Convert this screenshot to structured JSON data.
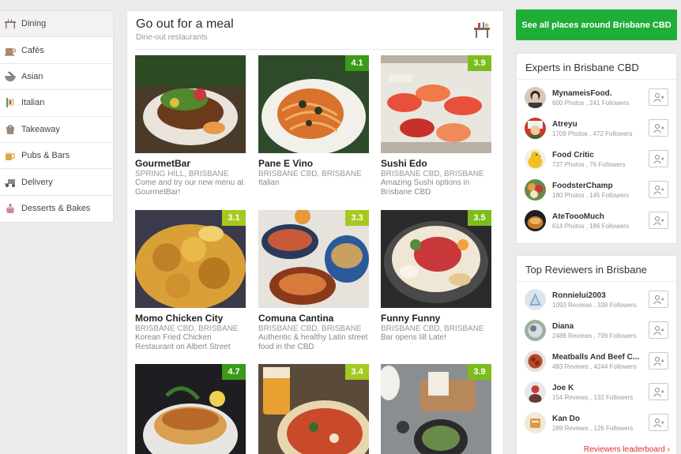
{
  "sidebar": {
    "items": [
      {
        "label": "Dining",
        "icon": "dining-icon"
      },
      {
        "label": "Cafés",
        "icon": "cafe-icon"
      },
      {
        "label": "Asian",
        "icon": "asian-icon"
      },
      {
        "label": "Italian",
        "icon": "italian-icon"
      },
      {
        "label": "Takeaway",
        "icon": "takeaway-icon"
      },
      {
        "label": "Pubs & Bars",
        "icon": "pubs-icon"
      },
      {
        "label": "Delivery",
        "icon": "delivery-icon"
      },
      {
        "label": "Desserts & Bakes",
        "icon": "desserts-icon"
      }
    ]
  },
  "main": {
    "title": "Go out for a meal",
    "subtitle": "Dine-out restaurants",
    "icon": "table-setting-icon",
    "restaurants": [
      {
        "name": "GourmetBar",
        "location": "SPRING HILL, BRISBANE",
        "desc_1": "Come and try our new menu at",
        "desc_2": "GourmetBar!",
        "rating": ""
      },
      {
        "name": "Pane E Vino",
        "location": "BRISBANE CBD, BRISBANE",
        "desc_1": "Italian",
        "desc_2": "",
        "rating": "4.1"
      },
      {
        "name": "Sushi Edo",
        "location": "BRISBANE CBD, BRISBANE",
        "desc_1": "Amazing Sushi options in",
        "desc_2": "Brisbane CBD",
        "rating": "3.9"
      },
      {
        "name": "Momo Chicken City",
        "location": "BRISBANE CBD, BRISBANE",
        "desc_1": "Korean Fried Chicken",
        "desc_2": "Restaurant on Albert Street",
        "rating": "3.1"
      },
      {
        "name": "Comuna Cantina",
        "location": "BRISBANE CBD, BRISBANE",
        "desc_1": "Authentic & healthy Latin street",
        "desc_2": "food in the CBD",
        "rating": "3.3"
      },
      {
        "name": "Funny Funny",
        "location": "BRISBANE CBD, BRISBANE",
        "desc_1": "Bar opens till Late!",
        "desc_2": "",
        "rating": "3.5"
      },
      {
        "name": "",
        "location": "",
        "desc_1": "",
        "desc_2": "",
        "rating": "4.7"
      },
      {
        "name": "",
        "location": "",
        "desc_1": "",
        "desc_2": "",
        "rating": "3.4"
      },
      {
        "name": "",
        "location": "",
        "desc_1": "",
        "desc_2": "",
        "rating": "3.9"
      }
    ]
  },
  "cta": {
    "label": "See all places around Brisbane CBD"
  },
  "experts": {
    "title": "Experts in Brisbane CBD",
    "people": [
      {
        "name": "MynameisFood.",
        "stats": "600 Photos , 241 Followers"
      },
      {
        "name": "Atreyu",
        "stats": "1709 Photos , 472 Followers"
      },
      {
        "name": "Food Critic",
        "stats": "737 Photos , 76 Followers"
      },
      {
        "name": "FoodsterChamp",
        "stats": "180 Photos , 145 Followers"
      },
      {
        "name": "AteToooMuch",
        "stats": "614 Photos , 186 Followers"
      }
    ]
  },
  "reviewers": {
    "title": "Top Reviewers in Brisbane",
    "people": [
      {
        "name": "Ronnielui2003",
        "stats": "1093 Reviews , 339 Followers"
      },
      {
        "name": "Diana",
        "stats": "2488 Reviews , 799 Followers"
      },
      {
        "name": "Meatballs And Beef C...",
        "stats": "483 Reviews , 4244 Followers"
      },
      {
        "name": "Joe K",
        "stats": "154 Reviews , 132 Followers"
      },
      {
        "name": "Kan Do",
        "stats": "289 Reviews , 126 Followers"
      }
    ],
    "leaderboard_link": "Reviewers leaderboard ›"
  },
  "colors": {
    "brand_green": "#1fae37",
    "rating_dark": "#3c9a1a",
    "rating_mid": "#7cbd1c",
    "rating_light": "#a6c91f",
    "link_red": "#d9322c"
  }
}
